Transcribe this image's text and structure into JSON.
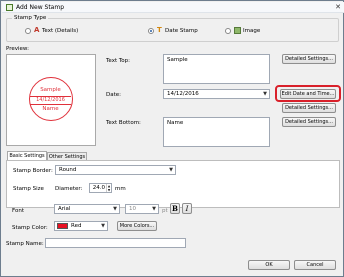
{
  "window": {
    "title": "Add New Stamp"
  },
  "stamp_type": {
    "label": "Stamp Type",
    "options": [
      {
        "label": "Text (Details)",
        "selected": false,
        "icon": "text-stamp-icon"
      },
      {
        "label": "Date Stamp",
        "selected": true,
        "icon": "date-stamp-icon"
      },
      {
        "label": "Image",
        "selected": false,
        "icon": "image-stamp-icon"
      }
    ]
  },
  "preview": {
    "label": "Preview:",
    "stamp": {
      "top": "Sample",
      "date": "14/12/2016",
      "bottom": "Name",
      "color": "#e0303a"
    }
  },
  "fields": {
    "text_top": {
      "label": "Text Top:",
      "value": "Sample",
      "button": "Detailed Settings..."
    },
    "date": {
      "label": "Date:",
      "value": "14/12/2016",
      "edit_button": "Edit Date and Time...",
      "button": "Detailed Settings..."
    },
    "text_bottom": {
      "label": "Text Bottom:",
      "value": "Name",
      "button": "Detailed Settings..."
    }
  },
  "tabs": [
    {
      "label": "Basic Settings",
      "active": true
    },
    {
      "label": "Other Settings",
      "active": false
    }
  ],
  "basic_settings": {
    "border": {
      "label": "Stamp Border:",
      "value": "Round"
    },
    "size": {
      "label": "Stamp Size",
      "sublabel": "Diameter:",
      "value": "24.0",
      "unit": "mm"
    },
    "font": {
      "label": "Font",
      "value": "Arial",
      "size_value": "10",
      "size_unit": "pt",
      "bold_label": "B",
      "italic_label": "I"
    },
    "color": {
      "label": "Stamp Color:",
      "value": "Red",
      "swatch": "#e81123",
      "more_button": "More Colors..."
    }
  },
  "stamp_name": {
    "label": "Stamp Name:",
    "value": ""
  },
  "footer": {
    "ok": "OK",
    "cancel": "Cancel"
  },
  "colors": {
    "highlight": "#d9202a",
    "accent": "#2b5fa6"
  }
}
